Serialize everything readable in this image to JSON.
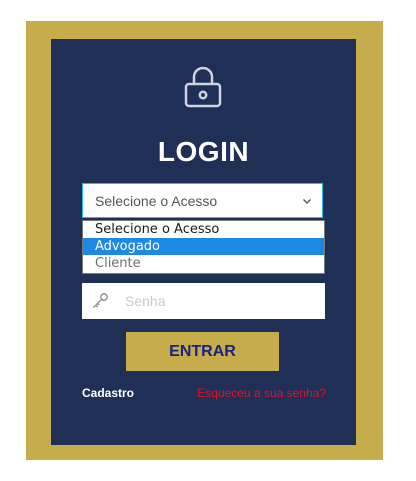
{
  "login": {
    "title": "LOGIN",
    "access_select": {
      "value": "Selecione o Acesso",
      "options": [
        "Selecione o Acesso",
        "Advogado",
        "Cliente"
      ],
      "highlighted": "Advogado"
    },
    "password": {
      "placeholder": "Senha",
      "value": ""
    },
    "submit_label": "ENTRAR",
    "register_link": "Cadastro",
    "forgot_link": "Esqueceu a sua senha?"
  },
  "icons": {
    "lock": "lock-icon",
    "key": "key-icon",
    "chevron": "chevron-down-icon"
  },
  "colors": {
    "frame": "#c7ac4c",
    "panel": "#1f2f55",
    "button": "#c7ac4c",
    "button_text": "#1a237e",
    "highlight": "#1e88e5",
    "forgot_link": "#e0142c"
  }
}
